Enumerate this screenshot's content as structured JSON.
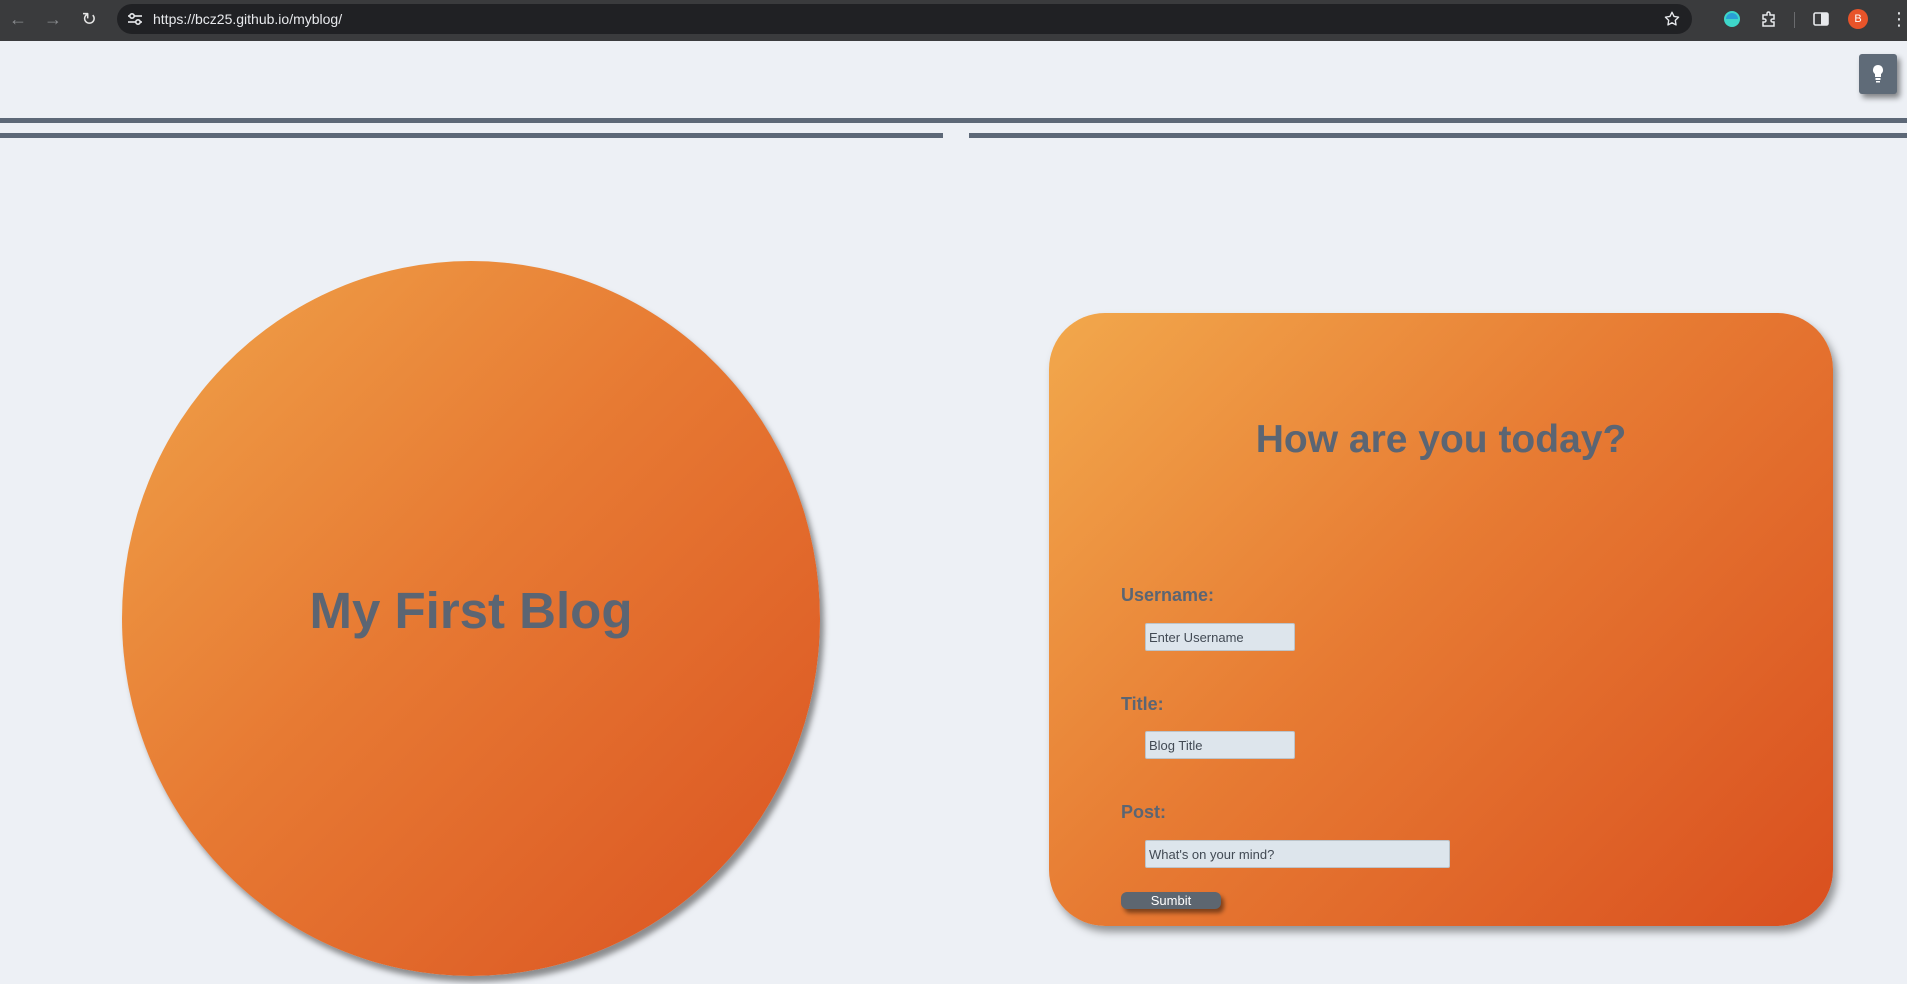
{
  "browser": {
    "url": "https://bcz25.github.io/myblog/",
    "back_icon": "arrow-left-icon",
    "forward_icon": "arrow-right-icon",
    "reload_icon": "reload-icon",
    "profile_initial": "B",
    "menu_glyph": "⋮"
  },
  "page": {
    "theme_toggle_icon": "lightbulb-icon",
    "hero_title": "My First Blog",
    "card_title": "How are you today?",
    "form": {
      "username_label": "Username:",
      "username_placeholder": "Enter Username",
      "title_label": "Title:",
      "title_placeholder": "Blog Title",
      "post_label": "Post:",
      "post_placeholder": "What's on your mind?",
      "submit_label": "Sumbit"
    }
  },
  "colors": {
    "page_bg": "#edf0f5",
    "accent_gradient_start": "#f0a44a",
    "accent_gradient_end": "#da5221",
    "text_slate": "#5b6573",
    "rule": "#5d6877"
  }
}
